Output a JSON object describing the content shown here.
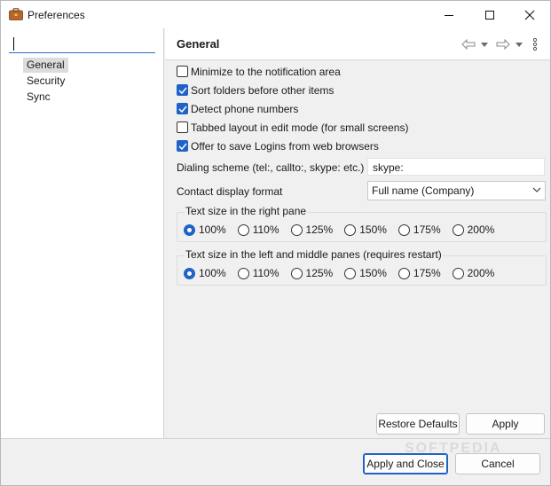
{
  "window": {
    "title": "Preferences"
  },
  "sidebar": {
    "filter_value": "",
    "items": [
      {
        "label": "General",
        "selected": true
      },
      {
        "label": "Security",
        "selected": false
      },
      {
        "label": "Sync",
        "selected": false
      }
    ]
  },
  "header": {
    "title": "General",
    "icons": [
      "back-arrow-icon",
      "dropdown-icon",
      "forward-arrow-icon",
      "dropdown-icon",
      "menu-icon"
    ]
  },
  "options": [
    {
      "label": "Minimize to the notification area",
      "checked": false
    },
    {
      "label": "Sort folders before other items",
      "checked": true
    },
    {
      "label": "Detect phone numbers",
      "checked": true
    },
    {
      "label": "Tabbed layout in edit mode (for small screens)",
      "checked": false
    },
    {
      "label": "Offer to save Logins from web browsers",
      "checked": true
    }
  ],
  "dialing": {
    "label": "Dialing scheme (tel:, callto:, skype: etc.)",
    "value": "skype:"
  },
  "contact_format": {
    "label": "Contact display format",
    "selected": "Full name (Company)"
  },
  "text_size_right": {
    "title": "Text size in the right pane",
    "options": [
      "100%",
      "110%",
      "125%",
      "150%",
      "175%",
      "200%"
    ],
    "selected": "100%"
  },
  "text_size_left": {
    "title": "Text size in the left and middle panes (requires restart)",
    "options": [
      "100%",
      "110%",
      "125%",
      "150%",
      "175%",
      "200%"
    ],
    "selected": "100%"
  },
  "buttons": {
    "restore_defaults": "Restore Defaults",
    "apply": "Apply",
    "apply_close": "Apply and Close",
    "cancel": "Cancel"
  },
  "watermark": "SOFTPEDIA",
  "colors": {
    "accent": "#1f63c7",
    "selection": "#dcdcdc"
  }
}
